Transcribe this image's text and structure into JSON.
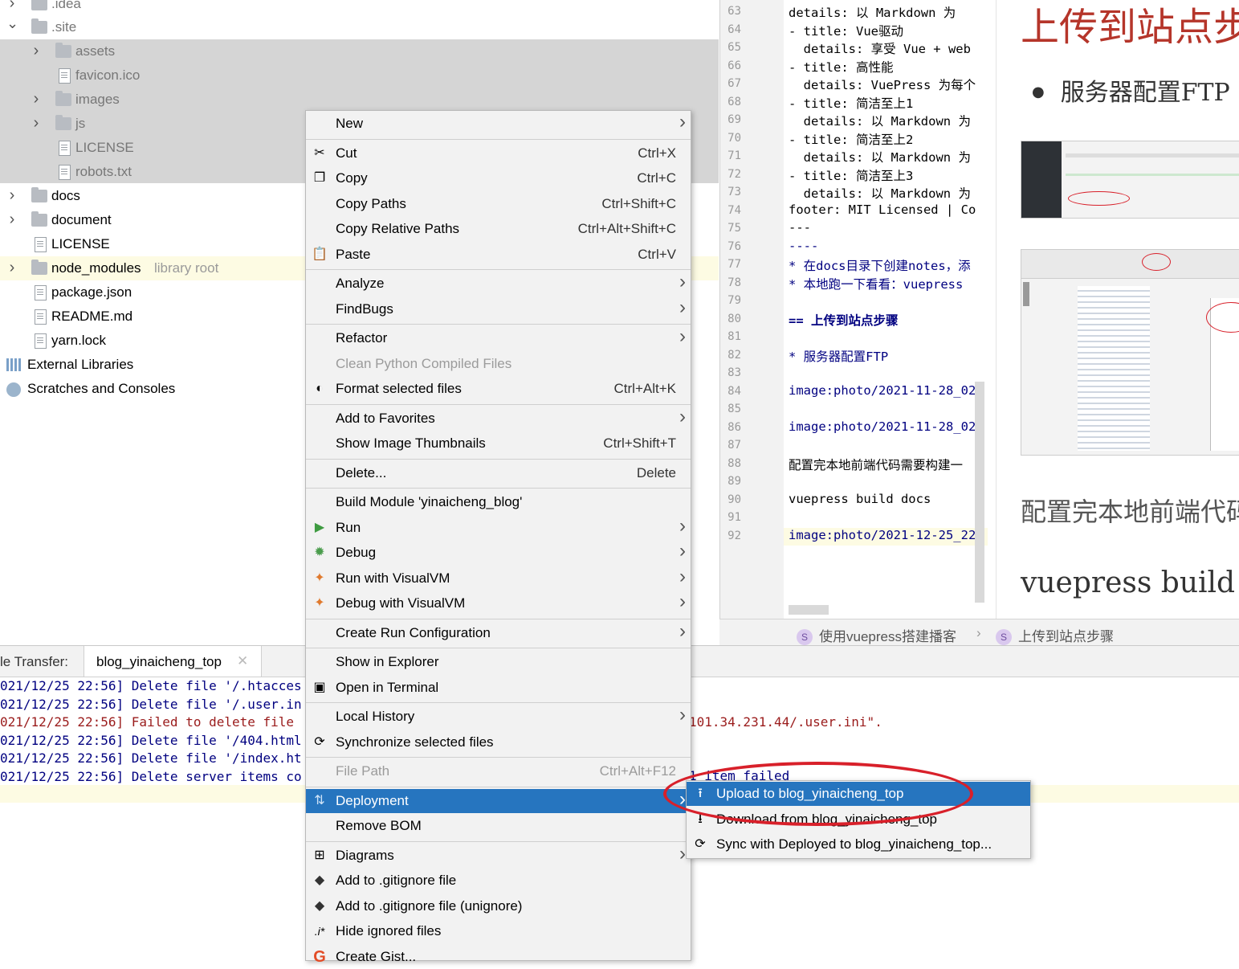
{
  "tree": {
    "items": [
      {
        "label": ".idea",
        "type": "folder",
        "expanded": false
      },
      {
        "label": ".site",
        "type": "folder",
        "expanded": true
      },
      {
        "label": "assets",
        "type": "folder",
        "expanded": false
      },
      {
        "label": "favicon.ico",
        "type": "file"
      },
      {
        "label": "images",
        "type": "folder",
        "expanded": false
      },
      {
        "label": "js",
        "type": "folder",
        "expanded": false
      },
      {
        "label": "LICENSE",
        "type": "file"
      },
      {
        "label": "robots.txt",
        "type": "file"
      },
      {
        "label": "docs",
        "type": "folder",
        "expanded": false
      },
      {
        "label": "document",
        "type": "folder",
        "expanded": false
      },
      {
        "label": "LICENSE",
        "type": "file"
      },
      {
        "label": "node_modules",
        "type": "folder",
        "expanded": false,
        "note": "library root"
      },
      {
        "label": "package.json",
        "type": "file"
      },
      {
        "label": "README.md",
        "type": "file"
      },
      {
        "label": "yarn.lock",
        "type": "file"
      },
      {
        "label": "External Libraries",
        "type": "lib"
      },
      {
        "label": "Scratches and Consoles",
        "type": "scratch"
      }
    ]
  },
  "editor": {
    "line_numbers": [
      "63",
      "64",
      "65",
      "66",
      "67",
      "68",
      "69",
      "70",
      "71",
      "72",
      "73",
      "74",
      "75",
      "76",
      "77",
      "78",
      "79",
      "80",
      "81",
      "82",
      "83",
      "84",
      "85",
      "86",
      "87",
      "88",
      "89",
      "90",
      "91",
      "92"
    ],
    "lines": [
      "details: 以 Markdown 为",
      "- title: Vue驱动",
      "  details: 享受 Vue + web",
      "- title: 高性能",
      "  details: VuePress 为每个",
      "- title: 简洁至上1",
      "  details: 以 Markdown 为",
      "- title: 简洁至上2",
      "  details: 以 Markdown 为",
      "- title: 简洁至上3",
      "  details: 以 Markdown 为",
      "footer: MIT Licensed | Co",
      "---",
      "----",
      "* 在docs目录下创建notes，添",
      "* 本地跑一下看看：vuepress",
      "",
      "== 上传到站点步骤",
      "",
      "* 服务器配置FTP",
      "",
      "image:photo/2021-11-28_02",
      "",
      "image:photo/2021-11-28_02",
      "",
      "配置完本地前端代码需要构建一",
      "",
      "vuepress build docs",
      "",
      "image:photo/2021-12-25_22"
    ],
    "breadcrumb": [
      "使用vuepress搭建播客",
      "上传到站点步骤"
    ]
  },
  "preview": {
    "heading": "上传到站点步",
    "bullet": "服务器配置FTP",
    "para": "配置完本地前端代码",
    "cmd": "vuepress build d"
  },
  "bottom": {
    "tab_prefix": "le Transfer:",
    "tab_name": "blog_yinaicheng_top",
    "logs": [
      {
        "text": "021/12/25 22:56] Delete file '/.htacces",
        "err": false
      },
      {
        "text": "021/12/25 22:56] Delete file '/.user.in",
        "err": false
      },
      {
        "text": "021/12/25 22:56] Failed to delete file",
        "err": true
      },
      {
        "text": "021/12/25 22:56] Delete file '/404.html",
        "err": false
      },
      {
        "text": "021/12/25 22:56] Delete file '/index.ht",
        "err": false
      },
      {
        "text": "021/12/25 22:56] Delete server items co",
        "err": false
      }
    ],
    "log_tail_err": "101.34.231.44/.user.ini\".",
    "log_tail_last": "1 item failed"
  },
  "menu": {
    "items": [
      {
        "label": "New",
        "submenu": true
      },
      {
        "sep": true
      },
      {
        "label": "Cut",
        "shortcut": "Ctrl+X",
        "icon": "scissors-icon"
      },
      {
        "label": "Copy",
        "shortcut": "Ctrl+C",
        "icon": "copy-icon"
      },
      {
        "label": "Copy Paths",
        "shortcut": "Ctrl+Shift+C"
      },
      {
        "label": "Copy Relative Paths",
        "shortcut": "Ctrl+Alt+Shift+C"
      },
      {
        "label": "Paste",
        "shortcut": "Ctrl+V",
        "icon": "clipboard-icon"
      },
      {
        "sep": true
      },
      {
        "label": "Analyze",
        "submenu": true
      },
      {
        "label": "FindBugs",
        "submenu": true
      },
      {
        "sep": true
      },
      {
        "label": "Refactor",
        "submenu": true
      },
      {
        "label": "Clean Python Compiled Files",
        "disabled": true
      },
      {
        "label": "Format selected files",
        "shortcut": "Ctrl+Alt+K",
        "icon": "format-icon"
      },
      {
        "sep": true
      },
      {
        "label": "Add to Favorites",
        "submenu": true
      },
      {
        "label": "Show Image Thumbnails",
        "shortcut": "Ctrl+Shift+T"
      },
      {
        "sep": true
      },
      {
        "label": "Delete...",
        "shortcut": "Delete"
      },
      {
        "sep": true
      },
      {
        "label": "Build Module 'yinaicheng_blog'"
      },
      {
        "label": "Run",
        "submenu": true,
        "icon": "run-icon"
      },
      {
        "label": "Debug",
        "submenu": true,
        "icon": "debug-icon"
      },
      {
        "label": "Run with VisualVM",
        "submenu": true,
        "icon": "visualvm-run-icon"
      },
      {
        "label": "Debug with VisualVM",
        "submenu": true,
        "icon": "visualvm-debug-icon"
      },
      {
        "sep": true
      },
      {
        "label": "Create Run Configuration",
        "submenu": true
      },
      {
        "sep": true
      },
      {
        "label": "Show in Explorer"
      },
      {
        "label": "Open in Terminal",
        "icon": "terminal-icon"
      },
      {
        "sep": true
      },
      {
        "label": "Local History",
        "submenu": true
      },
      {
        "label": "Synchronize selected files",
        "icon": "sync-icon"
      },
      {
        "sep": true
      },
      {
        "label": "File Path",
        "shortcut": "Ctrl+Alt+F12",
        "disabled": true
      },
      {
        "sep": true
      },
      {
        "label": "Deployment",
        "submenu": true,
        "highlighted": true,
        "icon": "deployment-icon"
      },
      {
        "label": "Remove BOM"
      },
      {
        "sep": true
      },
      {
        "label": "Diagrams",
        "submenu": true,
        "icon": "diagram-icon"
      },
      {
        "label": "Add to .gitignore file",
        "icon": "git-icon"
      },
      {
        "label": "Add to .gitignore file (unignore)",
        "icon": "git-icon"
      },
      {
        "label": "Hide ignored files",
        "icon": "ignore-icon"
      },
      {
        "label": "Create Gist...",
        "icon": "gist-icon"
      }
    ]
  },
  "submenu": {
    "items": [
      {
        "label": "Upload to blog_yinaicheng_top",
        "highlighted": true,
        "icon": "upload-icon"
      },
      {
        "label": "Download from blog_yinaicheng_top",
        "icon": "download-icon"
      },
      {
        "label": "Sync with Deployed to blog_yinaicheng_top...",
        "icon": "sync-icon"
      }
    ]
  },
  "colors": {
    "highlight": "#2675bf",
    "annotation_circle": "#d8202a",
    "error_log": "#9a1b1b",
    "info_log": "#000080"
  }
}
